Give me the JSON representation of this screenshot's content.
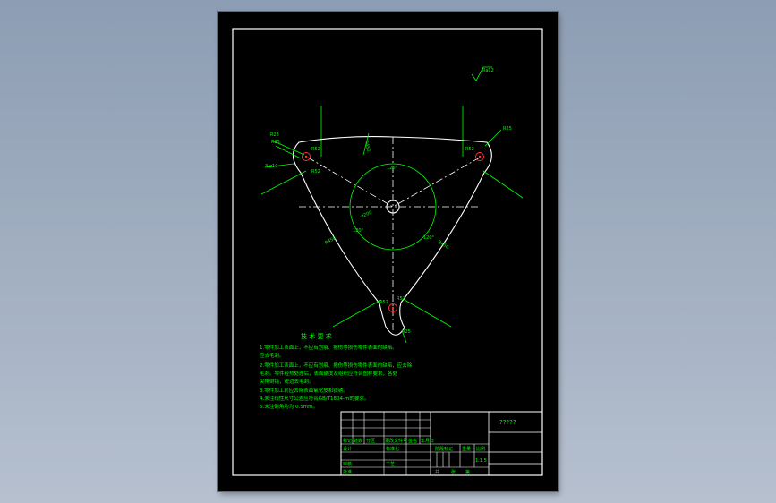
{
  "labels": {
    "surface_finish": "Ra12",
    "r23": "R23",
    "r25_left": "R25",
    "r25_right": "R25",
    "r25_bottom": "R25",
    "r52_left_top": "R52",
    "r52_left_mid": "R52",
    "r52_right": "R52",
    "r52_bottom_l": "R52",
    "r52_bottom_r": "R52",
    "holes": "3-ø10",
    "angle_top": "120°",
    "angle_left": "120°",
    "angle_right": "120°",
    "dia_circle": "ø200",
    "r450_top": "R450",
    "r450_left": "R450",
    "r450_right": "R450"
  },
  "notes": {
    "title": "技 术 要 求",
    "line1": "1.零件加工表面上，不应有划痕、擦伤等损伤零件表面的缺陷。",
    "line1b": "  应去毛刺。",
    "line2": "2.零件加工表面上，不应有划痕、擦伤等损伤零件表面的缺陷，应去除",
    "line2b": "  毛刺。零件经热处理后，表面硬度及组织应符合图样要求，各处",
    "line2c": "  尖角倒钝，锐边去毛刺。",
    "line3": "3.零件加工前应去除表面氧化皮和铁锈。",
    "line4": "4.未注线性尺寸公差应符合GB/T1804-m的要求。",
    "line5": "5.未注倒角均为 0.5mm。"
  },
  "title_block": {
    "drawing_name": "?????",
    "mark": "标记",
    "count": "处数",
    "zone": "分区",
    "doc_no": "更改文件号",
    "sign": "签名",
    "date": "年月日",
    "design": "设计",
    "standard": "标准化",
    "stage_mark": "阶段标记",
    "weight": "重量",
    "scale": "比例",
    "scale_val": "1:1.5",
    "check": "审核",
    "process": "工艺",
    "approve": "批准",
    "total": "共",
    "sheets": "张",
    "page": "第"
  }
}
